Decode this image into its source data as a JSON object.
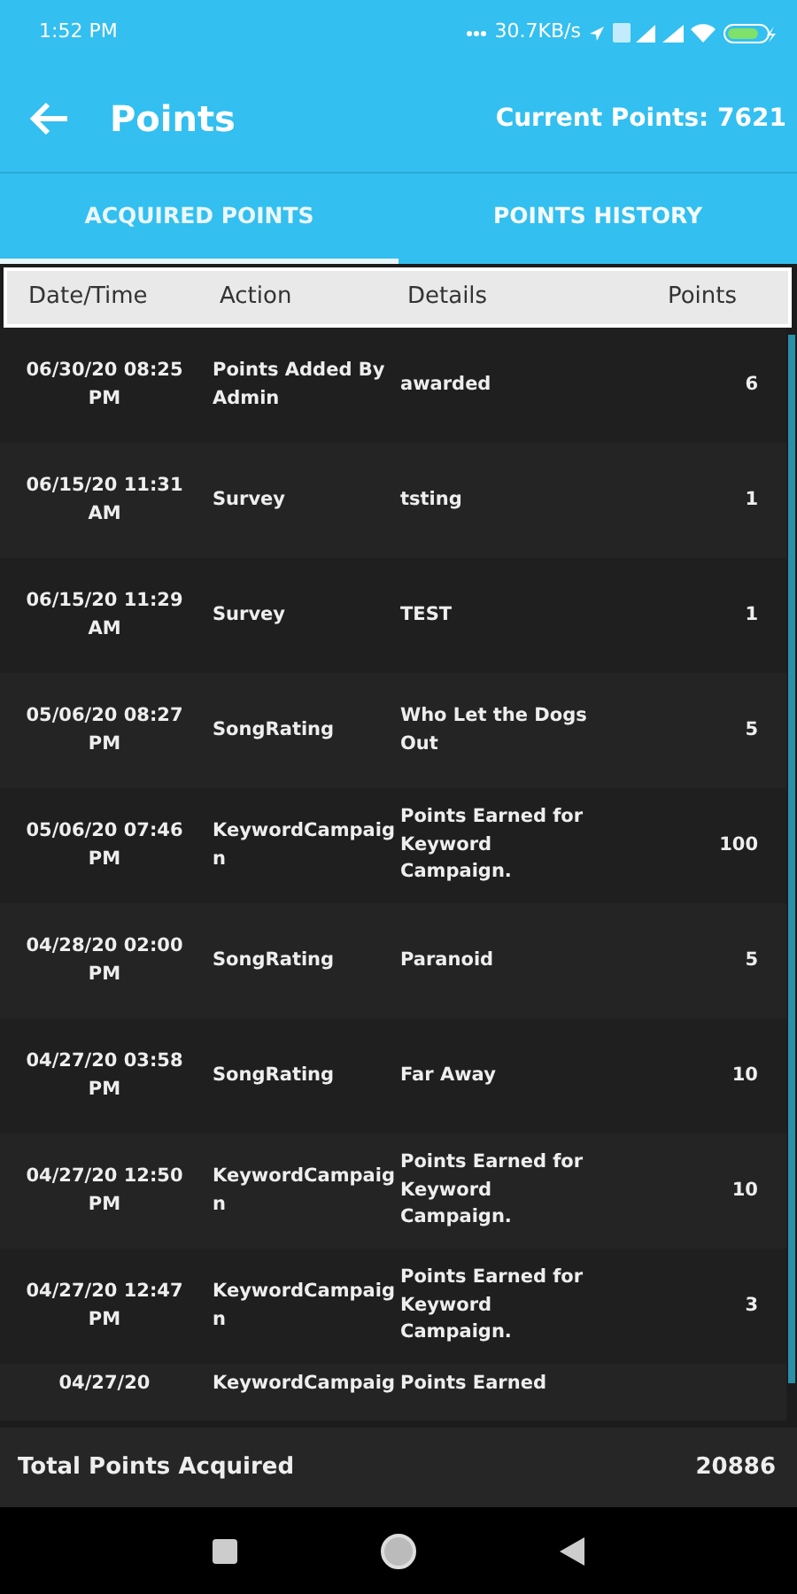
{
  "status_bar": {
    "time": "1:52 PM",
    "speed": "30.7KB/s"
  },
  "app_bar": {
    "title": "Points",
    "current_points": "Current Points: 7621"
  },
  "tabs": [
    {
      "label": "ACQUIRED POINTS",
      "selected": true
    },
    {
      "label": "POINTS HISTORY",
      "selected": false
    }
  ],
  "table": {
    "columns": [
      "Date/Time",
      "Action",
      "Details",
      "Points"
    ],
    "rows": [
      {
        "date": "06/30/20 08:25 PM",
        "action": "Points Added By Admin",
        "details": "awarded",
        "points": "6"
      },
      {
        "date": "06/15/20 11:31 AM",
        "action": "Survey",
        "details": "tsting",
        "points": "1"
      },
      {
        "date": "06/15/20 11:29 AM",
        "action": "Survey",
        "details": "TEST",
        "points": "1"
      },
      {
        "date": "05/06/20 08:27 PM",
        "action": "SongRating",
        "details": "Who Let the Dogs Out",
        "points": "5"
      },
      {
        "date": "05/06/20 07:46 PM",
        "action": "KeywordCampaign",
        "details": "Points Earned for Keyword Campaign.",
        "points": "100"
      },
      {
        "date": "04/28/20 02:00 PM",
        "action": "SongRating",
        "details": "Paranoid",
        "points": "5"
      },
      {
        "date": "04/27/20 03:58 PM",
        "action": "SongRating",
        "details": "Far Away",
        "points": "10"
      },
      {
        "date": "04/27/20 12:50 PM",
        "action": "KeywordCampaign",
        "details": "Points Earned for Keyword Campaign.",
        "points": "10"
      },
      {
        "date": "04/27/20 12:47 PM",
        "action": "KeywordCampaign",
        "details": "Points Earned for Keyword Campaign.",
        "points": "3"
      },
      {
        "date": "04/27/20",
        "action": "KeywordCampaig",
        "details": "Points Earned",
        "partial": true
      }
    ]
  },
  "footer": {
    "label": "Total Points Acquired",
    "total": "20886"
  }
}
